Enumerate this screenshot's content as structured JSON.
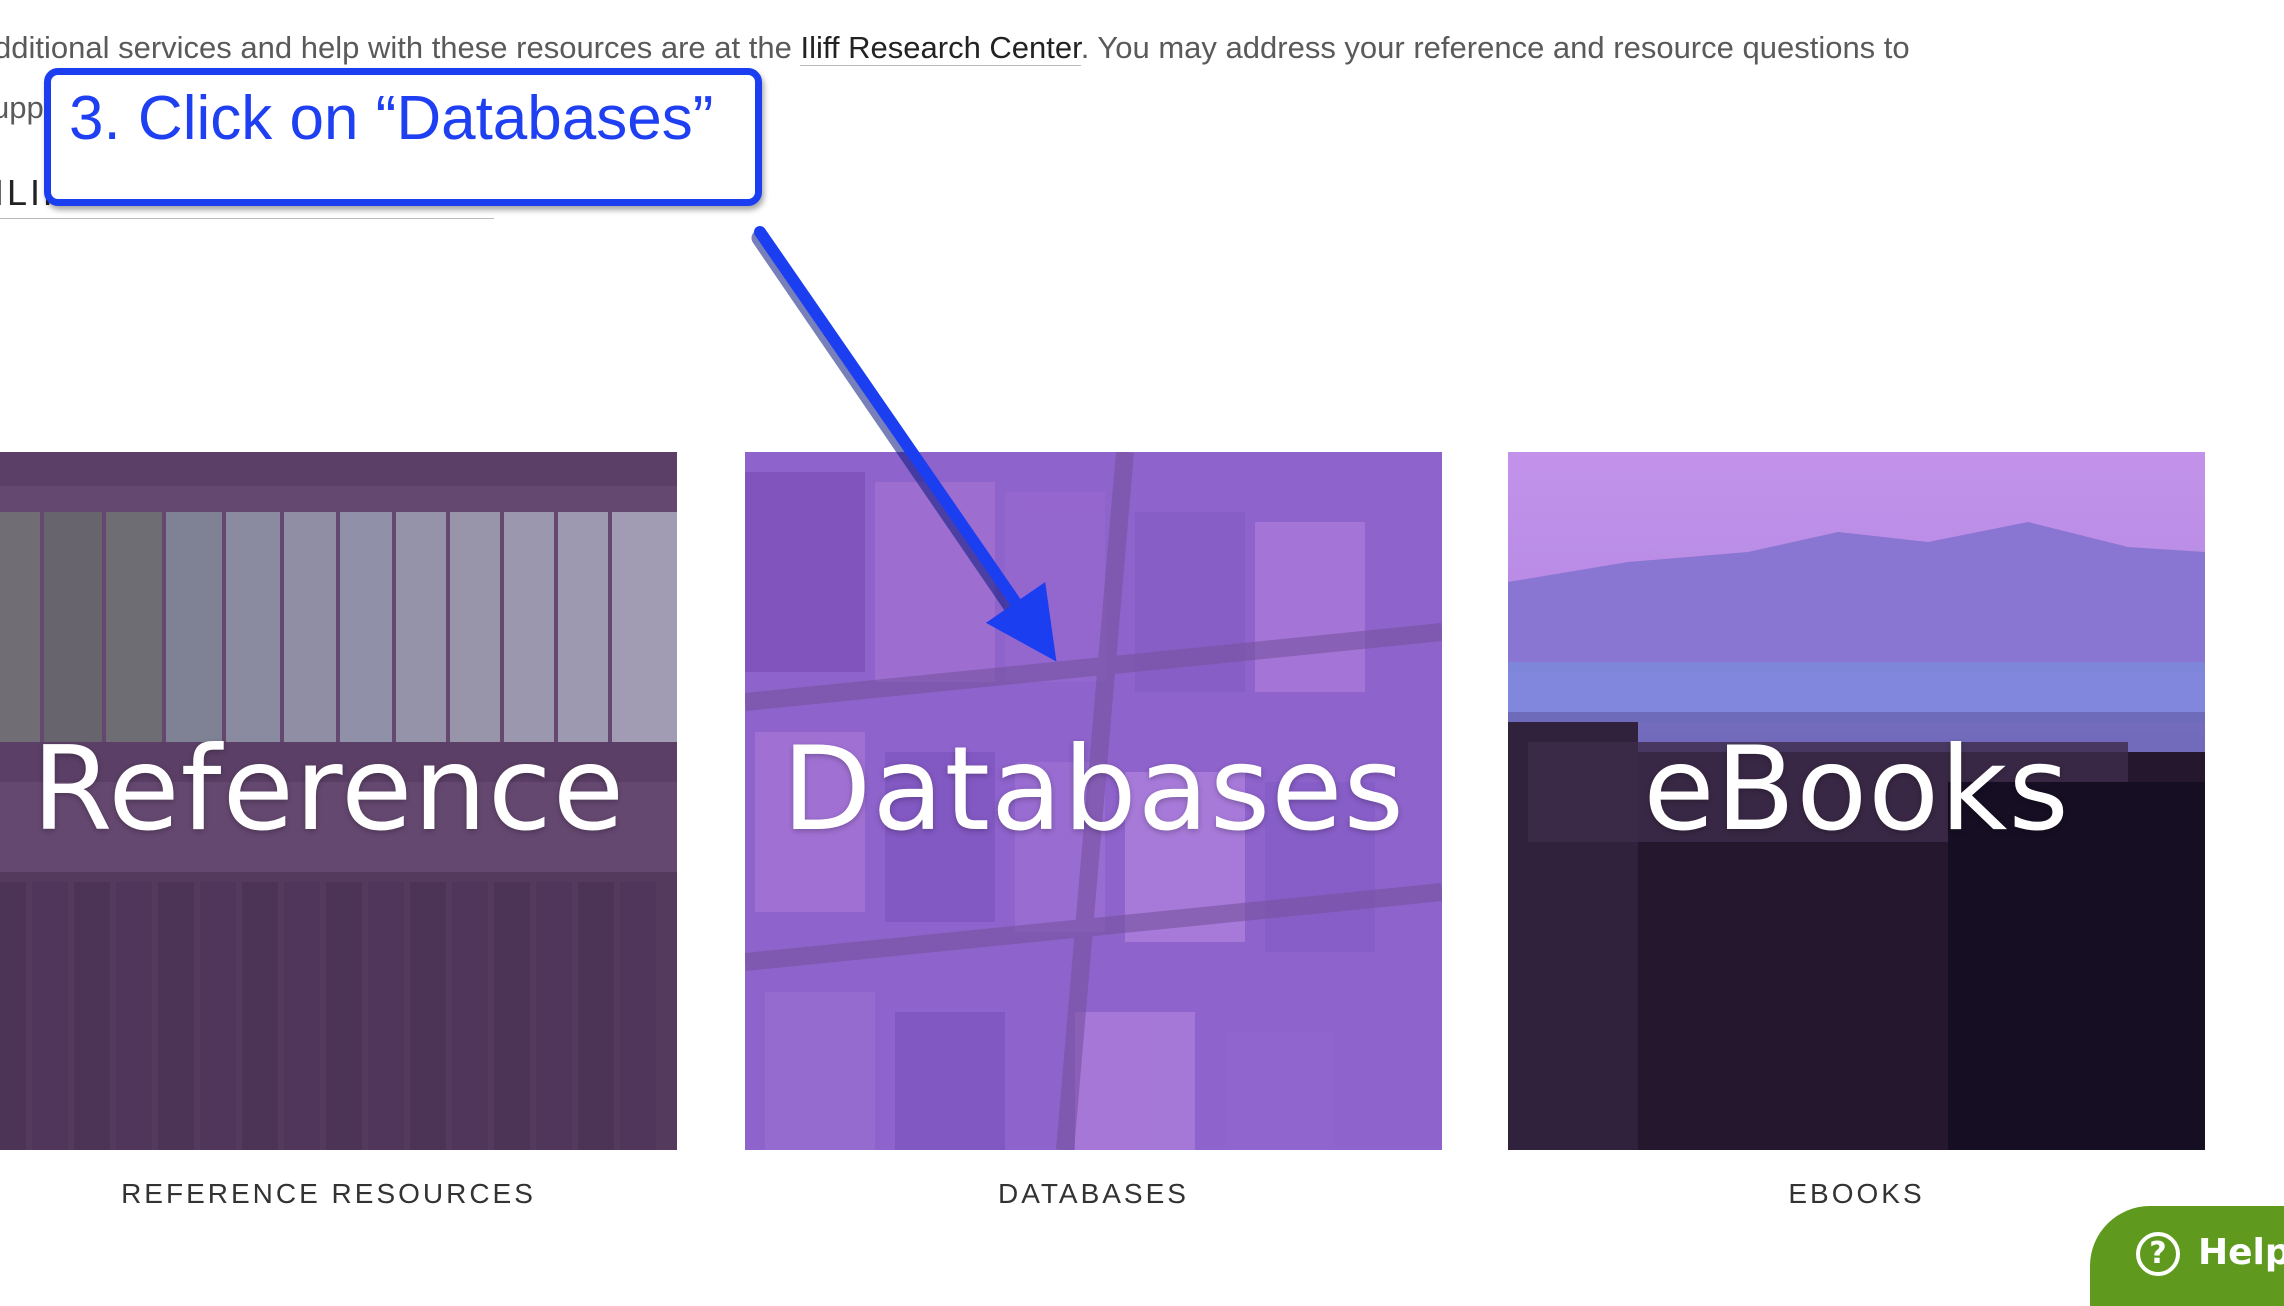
{
  "intro": {
    "line1_before": "dditional services and help with these resources are at the ",
    "line1_link": "Iliff Research Center",
    "line1_after": ". You may address your reference and resource questions to",
    "line2_text": "upp"
  },
  "section_link": "ILIFF RESEARCH RESOURCES",
  "tiles": [
    {
      "title": "Reference",
      "caption": "REFERENCE RESOURCES"
    },
    {
      "title": "Databases",
      "caption": "DATABASES"
    },
    {
      "title": "eBooks",
      "caption": "EBOOKS"
    }
  ],
  "callout": {
    "text": "3. Click on “Databases”",
    "color": "#1f3ff2"
  },
  "help": {
    "label": "Help",
    "color": "#5f9a1f"
  },
  "icons": {
    "help": "question-circle-icon"
  }
}
